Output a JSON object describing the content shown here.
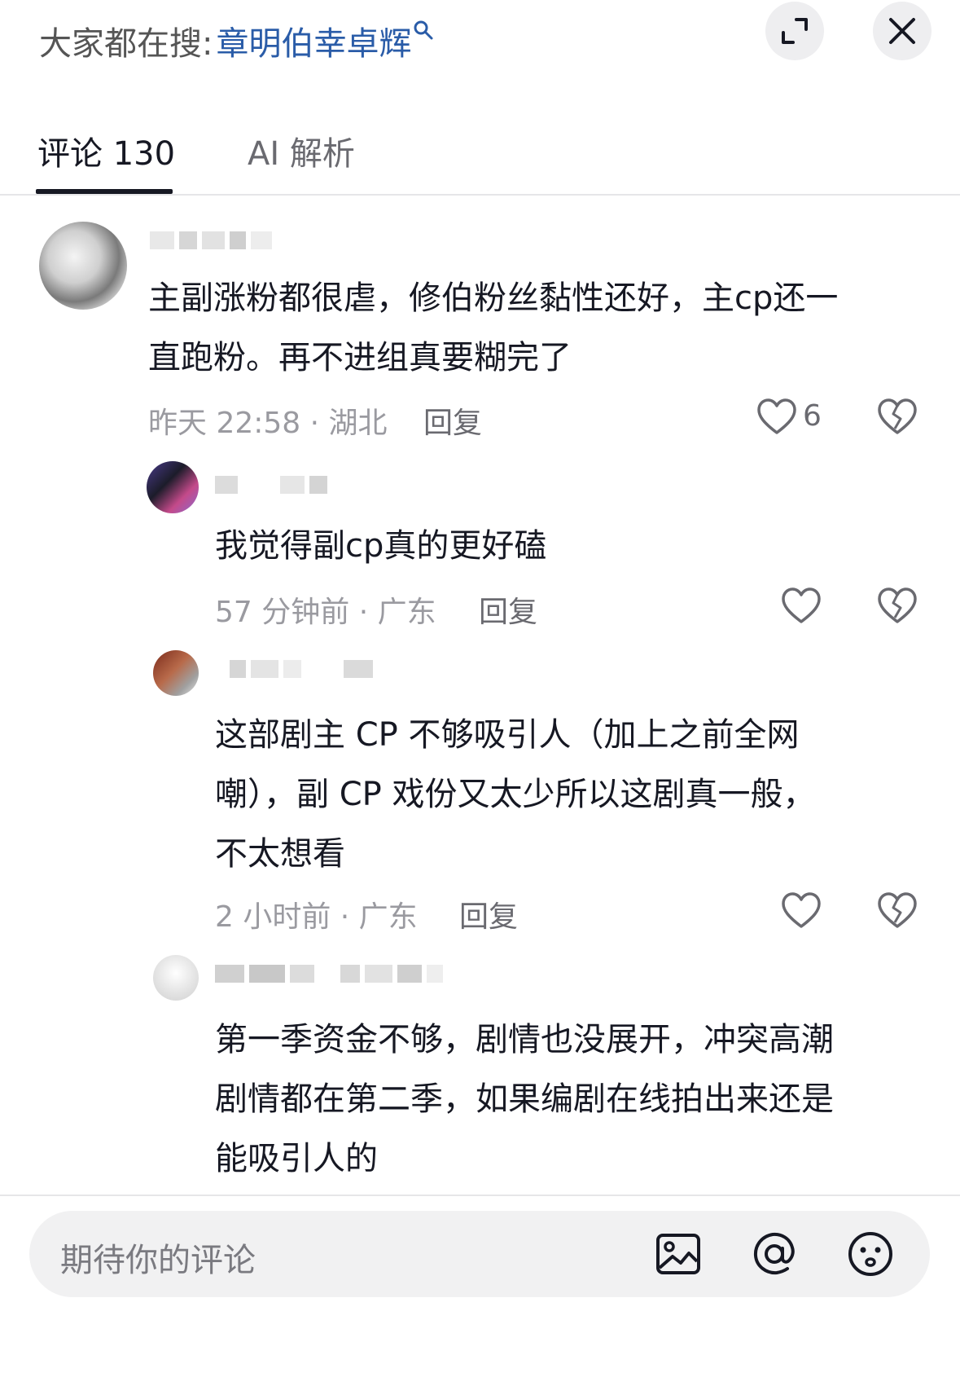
{
  "header": {
    "search_prefix": "大家都在搜:",
    "search_term": "章明伯幸卓辉",
    "search_icon": "search-icon",
    "expand_icon": "expand-icon",
    "close_icon": "close-icon"
  },
  "tabs": [
    {
      "label": "评论 130",
      "active": true
    },
    {
      "label": "AI 解析",
      "active": false
    }
  ],
  "comments": [
    {
      "text_lines": [
        "主副涨粉都很虐，修伯粉丝黏性还好，主cp还一",
        "直跑粉。再不进组真要糊完了"
      ],
      "meta": "昨天 22:58 · 湖北",
      "reply": "回复",
      "likes": "6"
    },
    {
      "text_lines": [
        "我觉得副cp真的更好磕"
      ],
      "meta": "57 分钟前 · 广东",
      "reply": "回复"
    },
    {
      "text_lines": [
        "这部剧主 CP 不够吸引人（加上之前全网",
        "嘲），副 CP 戏份又太少所以这剧真一般，",
        "不太想看"
      ],
      "meta": "2 小时前 · 广东",
      "reply": "回复"
    },
    {
      "text_lines": [
        "第一季资金不够，剧情也没展开，冲突高潮",
        "剧情都在第二季，如果编剧在线拍出来还是",
        "能吸引人的"
      ]
    }
  ],
  "input": {
    "placeholder": "期待你的评论",
    "icons": [
      "image-icon",
      "at-icon",
      "emoji-icon"
    ]
  },
  "colors": {
    "link_blue": "#2a5ca8",
    "text": "#161823",
    "meta_gray": "#9a9aa0",
    "input_bg": "#f1f1f2"
  }
}
